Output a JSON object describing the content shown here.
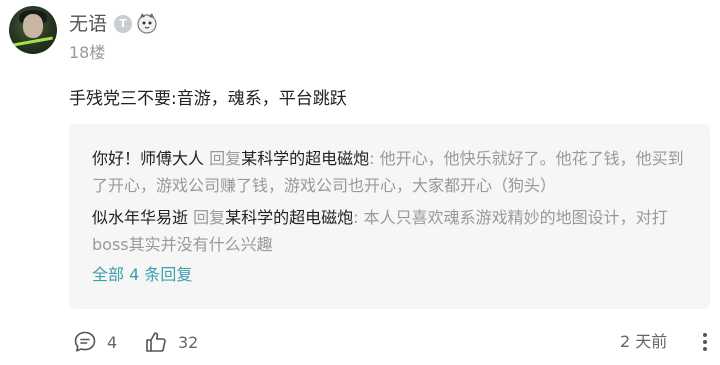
{
  "comment": {
    "username": "无语",
    "badge_t": "T",
    "floor": "18楼",
    "text": "手残党三不要:音游，魂系，平台跳跃"
  },
  "replies": [
    {
      "author": "你好！师傅大人",
      "verb": "回复",
      "target": "某科学的超电磁炮",
      "text": ": 他开心，他快乐就好了。他花了钱，他买到了开心，游戏公司赚了钱，游戏公司也开心，大家都开心（狗头）"
    },
    {
      "author": "似水年华易逝",
      "verb": "回复",
      "target": "某科学的超电磁炮",
      "text": ": 本人只喜欢魂系游戏精妙的地图设计，对打boss其实并没有什么兴趣"
    }
  ],
  "all_replies_label": "全部 4 条回复",
  "actions": {
    "comment_count": "4",
    "like_count": "32",
    "time": "2 天前"
  },
  "colors": {
    "link": "#3aa0ae",
    "reply_bg": "#f6f6f6"
  }
}
